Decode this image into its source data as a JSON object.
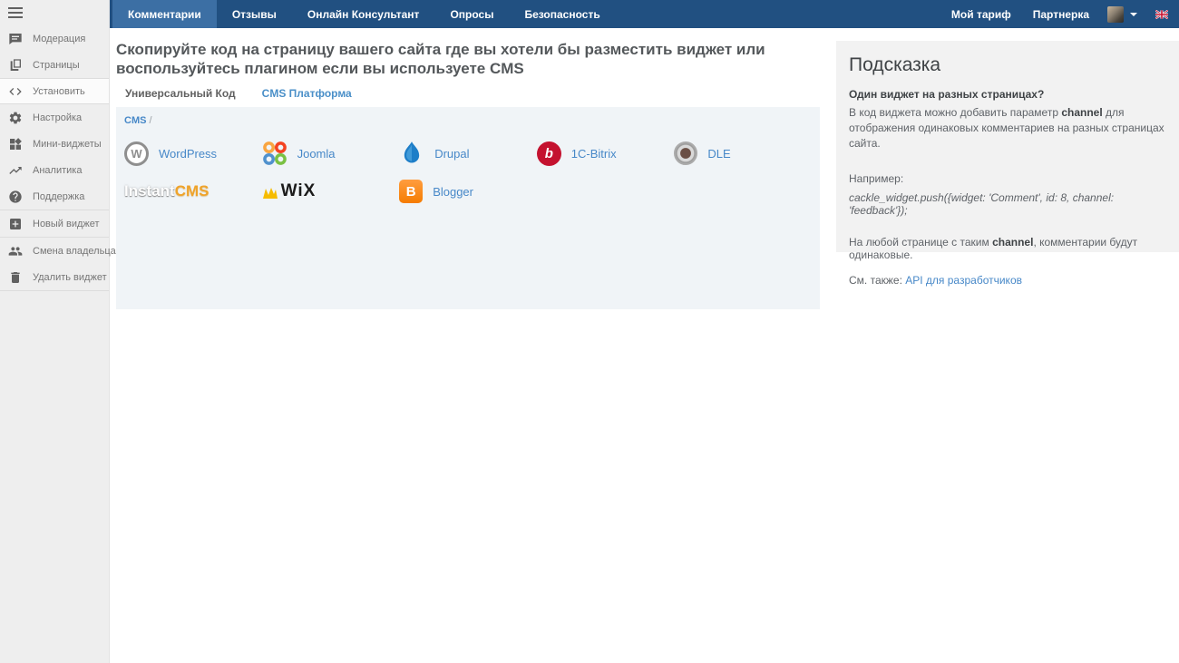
{
  "nav": {
    "tabs": [
      {
        "label": "Комментарии",
        "active": true
      },
      {
        "label": "Отзывы",
        "active": false
      },
      {
        "label": "Онлайн Консультант",
        "active": false
      },
      {
        "label": "Опросы",
        "active": false
      },
      {
        "label": "Безопасность",
        "active": false
      }
    ],
    "links": [
      {
        "label": "Мой тариф"
      },
      {
        "label": "Партнерка"
      }
    ],
    "language_flag": "uk-flag-icon"
  },
  "sidebar": {
    "items": [
      {
        "label": "Модерация",
        "icon": "chat-icon"
      },
      {
        "label": "Страницы",
        "icon": "pages-icon"
      },
      {
        "label": "Установить",
        "icon": "code-icon",
        "active": true
      },
      {
        "label": "Настройка",
        "icon": "gear-icon"
      },
      {
        "label": "Мини-виджеты",
        "icon": "widgets-icon"
      },
      {
        "label": "Аналитика",
        "icon": "trending-up-icon"
      },
      {
        "label": "Поддержка",
        "icon": "help-icon"
      },
      {
        "label": "Новый виджет",
        "icon": "add-box-icon"
      },
      {
        "label": "Смена владельца",
        "icon": "people-icon"
      },
      {
        "label": "Удалить виджет",
        "icon": "trash-icon"
      }
    ]
  },
  "main": {
    "heading": "Скопируйте код на страницу вашего сайта где вы хотели бы разместить виджет или воспользуйтесь плагином если вы используете CMS",
    "tabs": [
      {
        "label": "Универсальный Код",
        "active": false
      },
      {
        "label": "CMS Платформа",
        "active": true
      }
    ],
    "breadcrumb": {
      "root": "CMS",
      "separator": "/"
    },
    "platforms": [
      {
        "name": "WordPress",
        "initial": "W"
      },
      {
        "name": "Joomla"
      },
      {
        "name": "Drupal"
      },
      {
        "name": "1C-Bitrix",
        "initial": "b"
      },
      {
        "name": "DLE"
      },
      {
        "name": "InstantCMS",
        "logo_part1": "Instant",
        "logo_part2": "CMS"
      },
      {
        "name": "Wix",
        "logo_text": "WiX"
      },
      {
        "name": "Blogger",
        "initial": "B"
      }
    ]
  },
  "hint": {
    "title": "Подсказка",
    "question": "Один виджет на разных страницах?",
    "body_pre": "В код виджета можно добавить параметр ",
    "body_bold": "channel",
    "body_post": " для отображения одинаковых комментариев на разных страницах сайта.",
    "example_label": "Например:",
    "code": "cackle_widget.push({widget: 'Comment', id: 8, channel: 'feedback'});",
    "note_pre": "На любой странице с таким ",
    "note_bold": "channel",
    "note_post": ", комментарии будут одинаковые.",
    "see_also_label": "См. также:",
    "see_also_link": "API для разработчиков"
  },
  "colors": {
    "navbar": "#215081",
    "navbar_active_tab": "#3C6FA4",
    "link_blue": "#4788C8",
    "card_background": "#F0F4F7",
    "hint_background": "#F2F2F2",
    "sidebar_background": "#EEEEEE",
    "bitrix_red": "#C4122F",
    "blogger_orange": "#F57C00",
    "instantcms_orange": "#EFA32B"
  }
}
